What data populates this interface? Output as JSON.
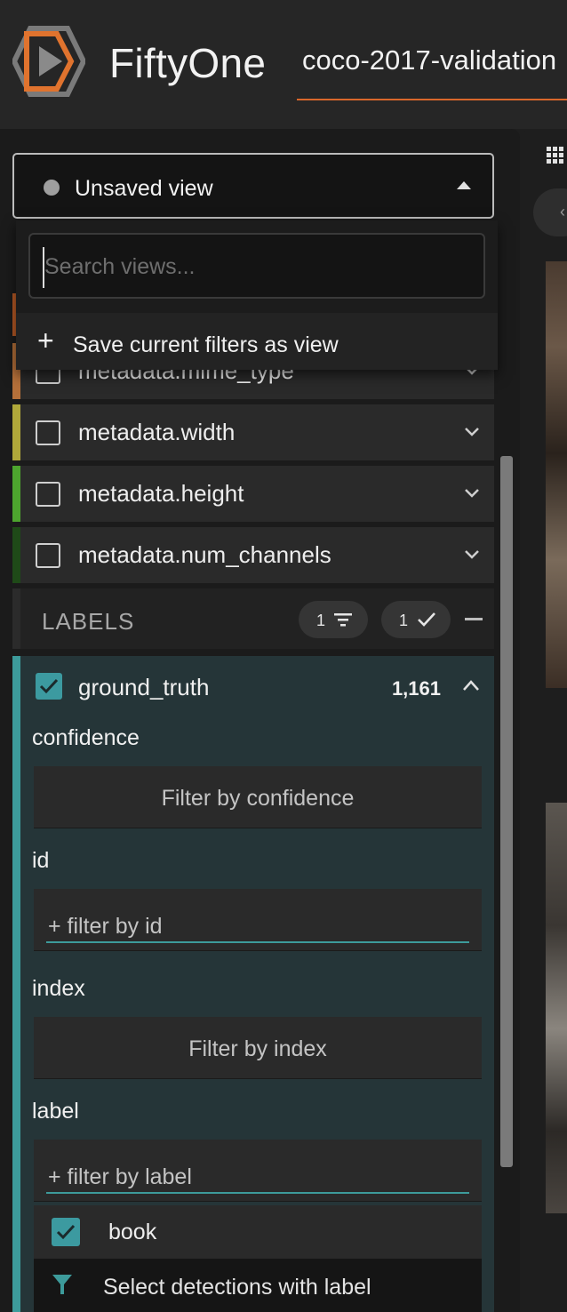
{
  "header": {
    "brand": "FiftyOne",
    "dataset_name": "coco-2017-validation",
    "accent_color": "#d9672b"
  },
  "views": {
    "current_view": "Unsaved view",
    "search_placeholder": "Search views...",
    "save_current": "Save current filters as view"
  },
  "fields": [
    {
      "name": "metadata.mime_type",
      "color": "#b5703a"
    },
    {
      "name": "metadata.width",
      "color": "#b0a83a"
    },
    {
      "name": "metadata.height",
      "color": "#4da52e"
    },
    {
      "name": "metadata.num_channels",
      "color": "#1f4a18"
    }
  ],
  "labels_section": {
    "title": "LABELS",
    "filter_count": "1",
    "visible_count": "1"
  },
  "ground_truth": {
    "name": "ground_truth",
    "count": "1,161",
    "color": "#3d9b9b",
    "attributes": {
      "confidence": {
        "label": "confidence",
        "placeholder": "Filter by confidence"
      },
      "id": {
        "label": "id",
        "placeholder": "+ filter by id"
      },
      "index": {
        "label": "index",
        "placeholder": "Filter by index"
      },
      "label": {
        "label": "label",
        "placeholder": "+ filter by label"
      }
    },
    "selected_value": "book",
    "select_action": "Select detections with label"
  }
}
